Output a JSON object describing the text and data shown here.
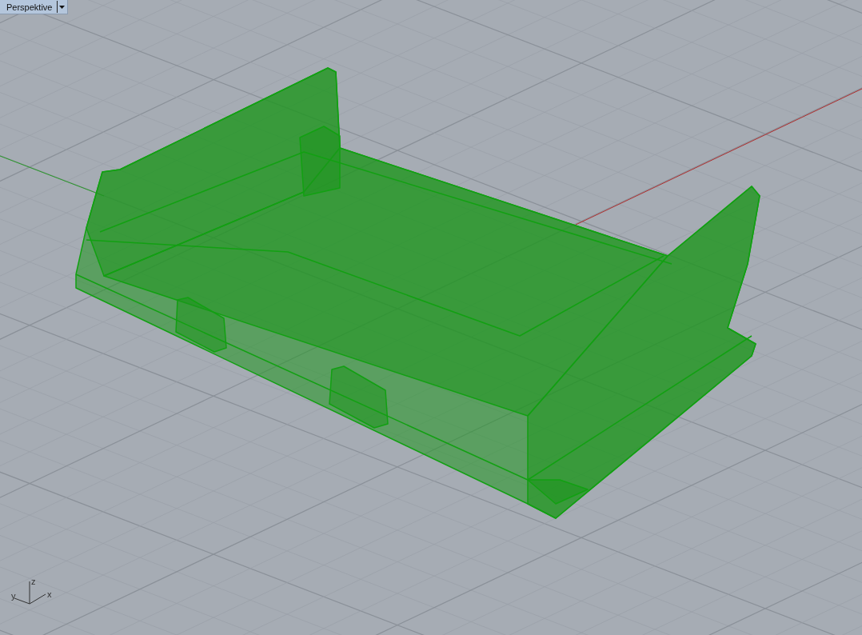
{
  "viewport": {
    "tab": {
      "label": "Perspektive"
    }
  },
  "axes_icon": {
    "z_label": "z",
    "y_label": "y",
    "x_label": "x"
  }
}
